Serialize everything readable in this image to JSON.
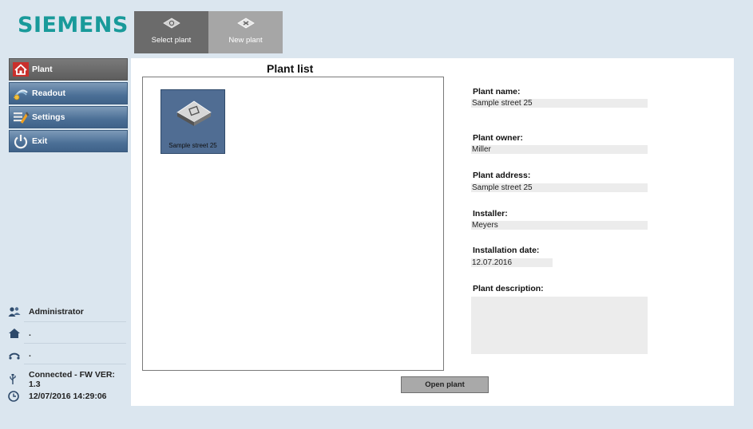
{
  "brand": {
    "logo_text": "SIEMENS"
  },
  "toolbar": {
    "select_plant": {
      "label": "Select plant",
      "icon": "select-plant-icon"
    },
    "new_plant": {
      "label": "New plant",
      "icon": "new-plant-icon"
    }
  },
  "nav": {
    "items": [
      {
        "label": "Plant",
        "icon": "house-icon",
        "active": true
      },
      {
        "label": "Readout",
        "icon": "readout-icon",
        "active": false
      },
      {
        "label": "Settings",
        "icon": "settings-icon",
        "active": false
      },
      {
        "label": "Exit",
        "icon": "power-icon",
        "active": false
      }
    ]
  },
  "status": {
    "user": "Administrator",
    "plant": ".",
    "meter": ".",
    "connection": "Connected - FW VER: 1.3",
    "datetime": "12/07/2016 14:29:06"
  },
  "plant_list": {
    "title": "Plant list",
    "tiles": [
      {
        "label": "Sample street 25"
      }
    ],
    "open_button": "Open plant"
  },
  "details": {
    "plant_name": {
      "label": "Plant name:",
      "value": "Sample street 25"
    },
    "plant_owner": {
      "label": "Plant owner:",
      "value": "Miller"
    },
    "plant_address": {
      "label": "Plant address:",
      "value": "Sample street 25"
    },
    "installer": {
      "label": "Installer:",
      "value": "Meyers"
    },
    "installation_date": {
      "label": "Installation date:",
      "value": "12.07.2016"
    },
    "plant_description": {
      "label": "Plant description:",
      "value": ""
    }
  },
  "colors": {
    "brand": "#199a9a",
    "background": "#dbe6ef",
    "nav_blue": "#4b6f96",
    "nav_active": "#5d5d5d",
    "tile": "#506d93"
  }
}
